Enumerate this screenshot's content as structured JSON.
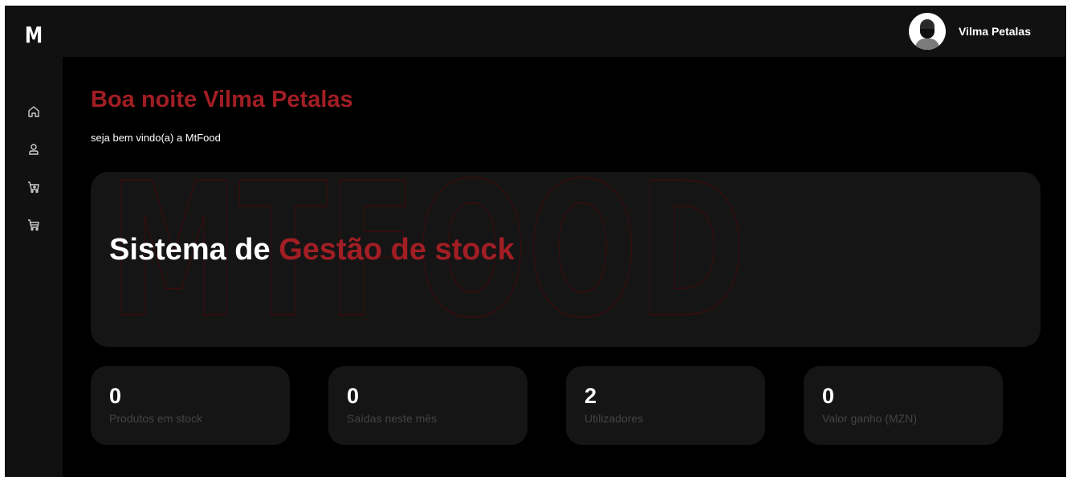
{
  "brand": {
    "logo_letter": "M"
  },
  "sidebar": {
    "items": [
      {
        "icon": "home-icon"
      },
      {
        "icon": "user-icon"
      },
      {
        "icon": "cart-plus-icon"
      },
      {
        "icon": "cart-icon"
      }
    ]
  },
  "topbar": {
    "user_name": "Vilma Petalas"
  },
  "greeting": {
    "title": "Boa noite Vilma Petalas",
    "subtitle": "seja bem vindo(a) a MtFood"
  },
  "hero": {
    "watermark": "MTFOOD",
    "title_prefix": "Sistema de",
    "title_accent": "Gestão de stock"
  },
  "stats": [
    {
      "value": "0",
      "label": "Produtos em stock"
    },
    {
      "value": "0",
      "label": "Saídas neste mês"
    },
    {
      "value": "2",
      "label": "Utilizadores"
    },
    {
      "value": "0",
      "label": "Valor ganho (MZN)"
    }
  ],
  "colors": {
    "accent": "#a11e24",
    "background": "#000000",
    "panel": "#111111",
    "card": "#151515"
  }
}
